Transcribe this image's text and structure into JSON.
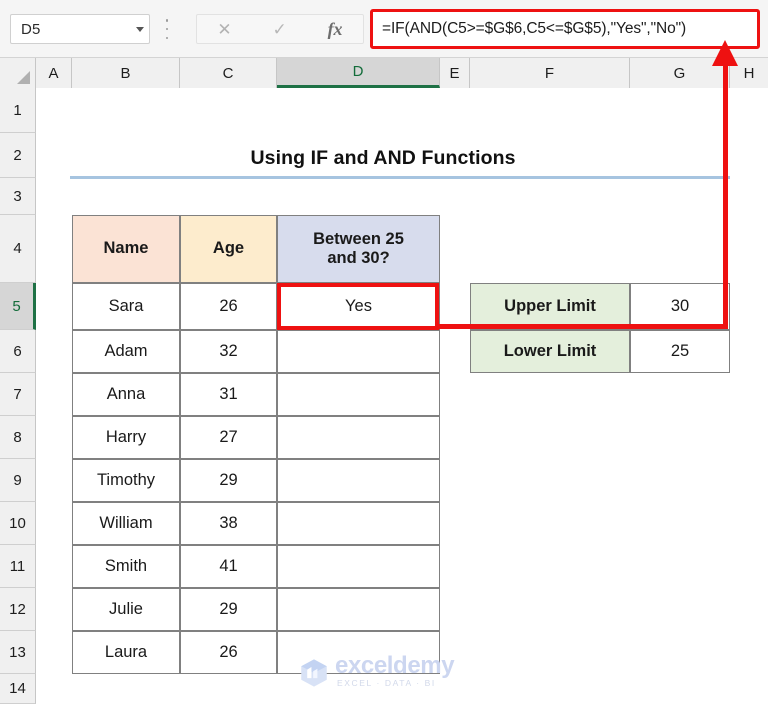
{
  "formula_bar": {
    "name_box_value": "D5",
    "formula": "=IF(AND(C5>=$G$6,C5<=$G$5),\"Yes\",\"No\")",
    "cancel_icon": "✕",
    "confirm_icon": "✓",
    "fx_icon": "fx"
  },
  "columns": [
    "A",
    "B",
    "C",
    "D",
    "E",
    "F",
    "G",
    "H"
  ],
  "selected_column": "D",
  "rows": [
    "1",
    "2",
    "3",
    "4",
    "5",
    "6",
    "7",
    "8",
    "9",
    "10",
    "11",
    "12",
    "13",
    "14"
  ],
  "selected_row": "5",
  "sheet": {
    "title": "Using IF and AND Functions"
  },
  "table": {
    "headers": [
      "Name",
      "Age",
      "Between 25 and 30?"
    ],
    "header_line1": "Between 25",
    "header_line2": "and 30?",
    "rows": [
      {
        "name": "Sara",
        "age": "26",
        "result": "Yes"
      },
      {
        "name": "Adam",
        "age": "32",
        "result": ""
      },
      {
        "name": "Anna",
        "age": "31",
        "result": ""
      },
      {
        "name": "Harry",
        "age": "27",
        "result": ""
      },
      {
        "name": "Timothy",
        "age": "29",
        "result": ""
      },
      {
        "name": "William",
        "age": "38",
        "result": ""
      },
      {
        "name": "Smith",
        "age": "41",
        "result": ""
      },
      {
        "name": "Julie",
        "age": "29",
        "result": ""
      },
      {
        "name": "Laura",
        "age": "26",
        "result": ""
      }
    ]
  },
  "limits_table": {
    "rows": [
      {
        "label": "Upper Limit",
        "value": "30"
      },
      {
        "label": "Lower Limit",
        "value": "25"
      }
    ]
  },
  "watermark": {
    "name": "exceldemy",
    "tagline": "EXCEL · DATA · BI"
  },
  "colors": {
    "annotation_red": "#ee1111",
    "header_name_bg": "#fbe3d5",
    "header_age_bg": "#fdeccd",
    "header_result_bg": "#d7dced",
    "limits_label_bg": "#e4efdc",
    "title_rule": "#a6c4e0",
    "selection_green": "#1e7145"
  }
}
